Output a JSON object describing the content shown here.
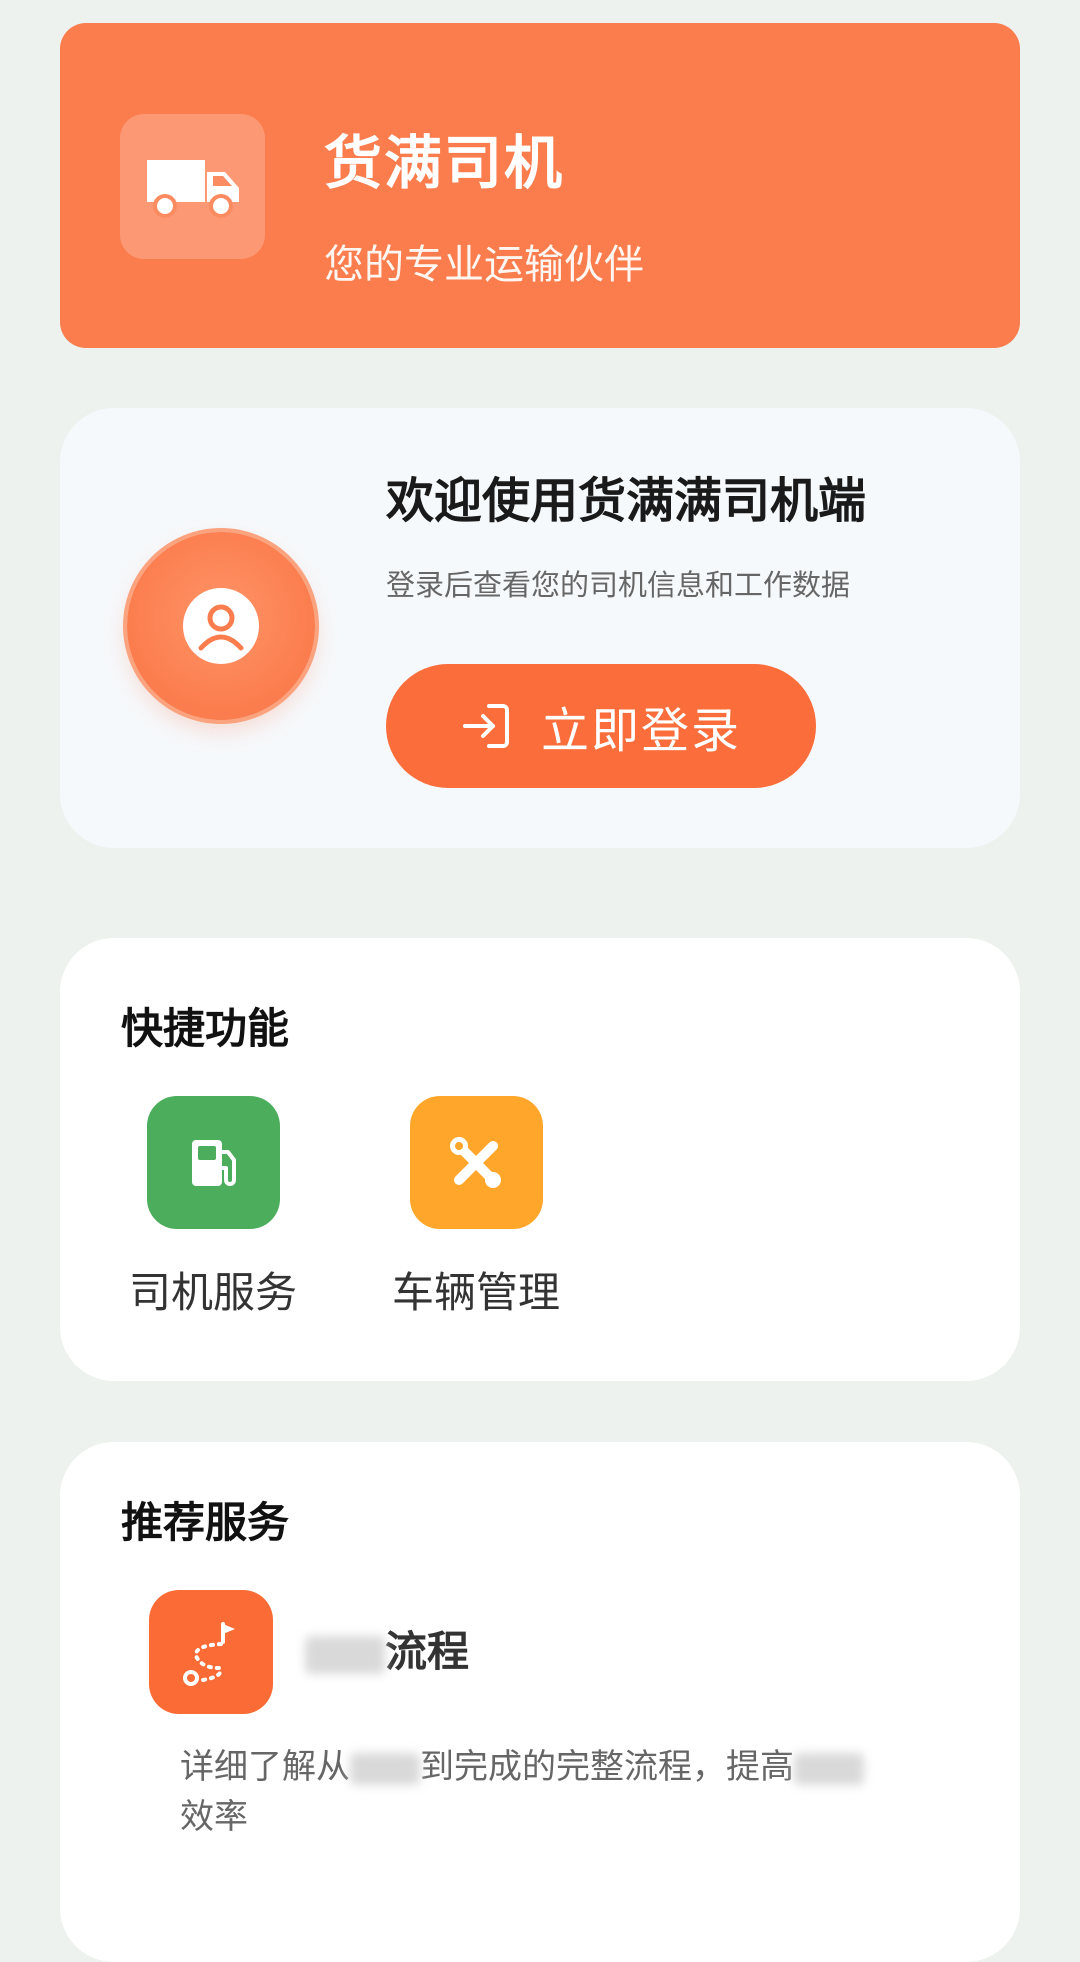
{
  "header": {
    "title": "货满司机",
    "subtitle": "您的专业运输伙伴",
    "icon": "truck-icon",
    "bg_color": "#fb7c4d"
  },
  "login_card": {
    "title": "欢迎使用货满满司机端",
    "description": "登录后查看您的司机信息和工作数据",
    "button_label": "立即登录",
    "button_icon": "login-icon",
    "avatar_icon": "user-avatar-icon",
    "button_color": "#fb6d3a"
  },
  "quick_functions": {
    "title": "快捷功能",
    "items": [
      {
        "label": "司机服务",
        "icon": "fuel-pump-icon",
        "color": "#4cae5c"
      },
      {
        "label": "车辆管理",
        "icon": "tools-icon",
        "color": "#ffa62b"
      }
    ]
  },
  "recommended": {
    "title": "推荐服务",
    "items": [
      {
        "title_visible": "流程",
        "desc_part1": "详细了解从",
        "desc_part2": "到完成的完整流程，提高",
        "desc_part3": "效率",
        "icon": "route-flag-icon",
        "color": "#fb6b36"
      }
    ]
  }
}
